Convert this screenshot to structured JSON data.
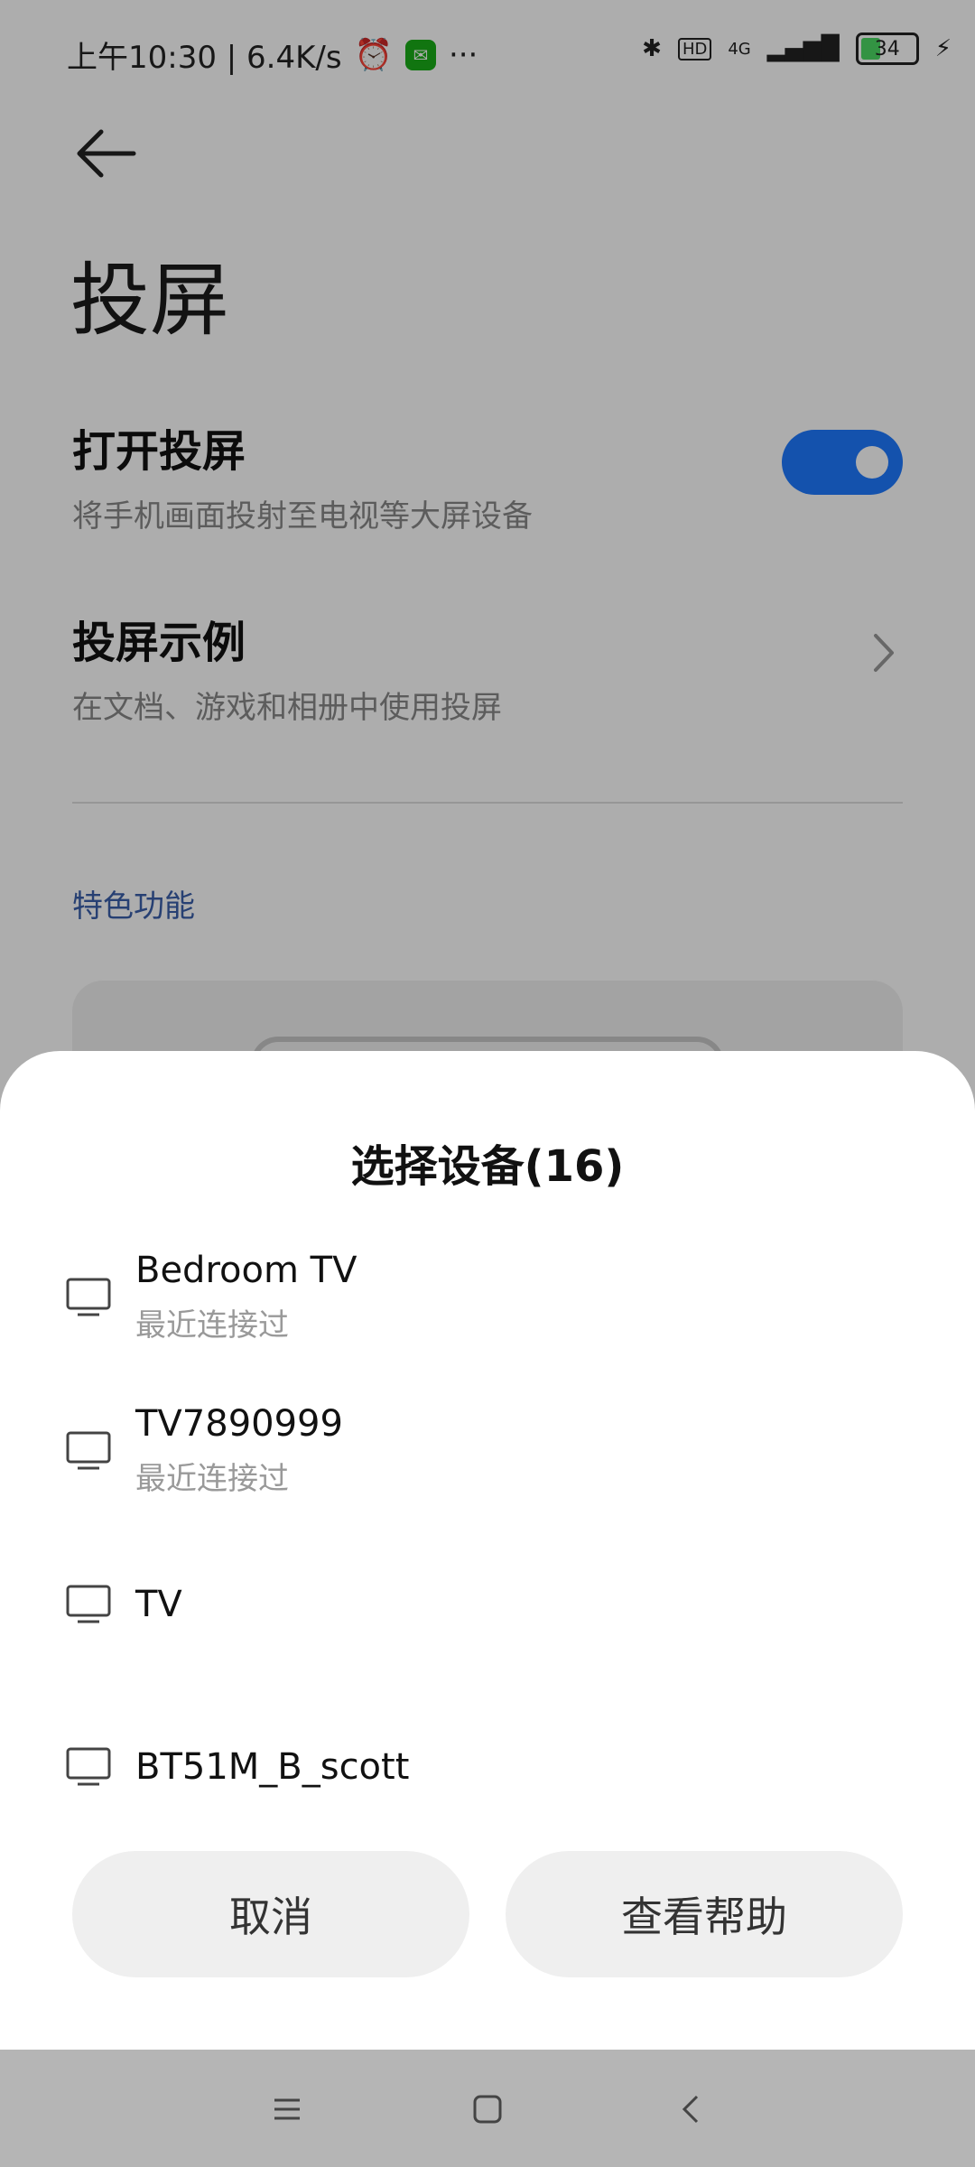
{
  "status_bar": {
    "time_speed": "上午10:30 | 6.4K/s",
    "more": "···",
    "network": "4G",
    "hd": "HD",
    "battery": "34"
  },
  "page": {
    "title": "投屏",
    "cast_toggle": {
      "title": "打开投屏",
      "subtitle": "将手机画面投射至电视等大屏设备",
      "on": true
    },
    "examples": {
      "title": "投屏示例",
      "subtitle": "在文档、游戏和相册中使用投屏"
    },
    "section_label": "特色功能"
  },
  "sheet": {
    "title": "选择设备(16)",
    "devices": [
      {
        "name": "Bedroom TV",
        "hint": "最近连接过"
      },
      {
        "name": "TV7890999",
        "hint": "最近连接过"
      },
      {
        "name": "TV",
        "hint": ""
      },
      {
        "name": "BT51M_B_scott",
        "hint": ""
      }
    ],
    "cancel_label": "取消",
    "help_label": "查看帮助"
  },
  "colors": {
    "accent": "#1e79ff",
    "section": "#3a5faa"
  }
}
